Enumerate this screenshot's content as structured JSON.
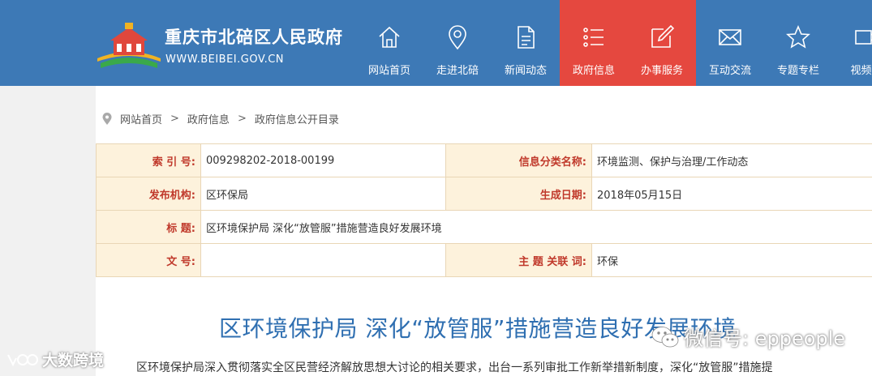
{
  "header": {
    "site_title": "重庆市北碚区人民政府",
    "site_domain": "WWW.BEIBEI.GOV.CN",
    "bg_color": "#3d79b6",
    "active_color": "#e5483f"
  },
  "nav": {
    "items": [
      {
        "label": "网站首页",
        "icon": "home-icon"
      },
      {
        "label": "走进北碚",
        "icon": "location-pin-icon"
      },
      {
        "label": "新闻动态",
        "icon": "document-icon"
      },
      {
        "label": "政府信息",
        "icon": "list-icon",
        "active": true
      },
      {
        "label": "办事服务",
        "icon": "edit-icon",
        "active": true
      },
      {
        "label": "互动交流",
        "icon": "mail-icon"
      },
      {
        "label": "专题专栏",
        "icon": "star-icon"
      },
      {
        "label": "视频中",
        "icon": "video-icon"
      }
    ]
  },
  "breadcrumb": {
    "items": [
      "网站首页",
      "政府信息",
      "政府信息公开目录"
    ],
    "separator": ">"
  },
  "info": {
    "index_label": "索 引 号:",
    "index_value": "009298202-2018-00199",
    "category_label": "信息分类名称:",
    "category_value": "环境监测、保护与治理/工作动态",
    "publisher_label": "发布机构:",
    "publisher_value": "区环保局",
    "date_label": "生成日期:",
    "date_value": "2018年05月15日",
    "title_label": "标 题:",
    "title_value": "区环境保护局 深化“放管服”措施营造良好发展环境",
    "docno_label": "文 号:",
    "docno_value": "",
    "keywords_label": "主 题 关联 词:",
    "keywords_value": "环保"
  },
  "article": {
    "title": "区环境保护局 深化“放管服”措施营造良好发展环境",
    "body_first_line": "区环境保护局深入贯彻落实全区民营经济解放思想大讨论的相关要求，出台一系列审批工作新举措新制度，深化“放管服”措施提"
  },
  "watermarks": {
    "left": "大数跨境",
    "right": "微信号: eppeople"
  }
}
